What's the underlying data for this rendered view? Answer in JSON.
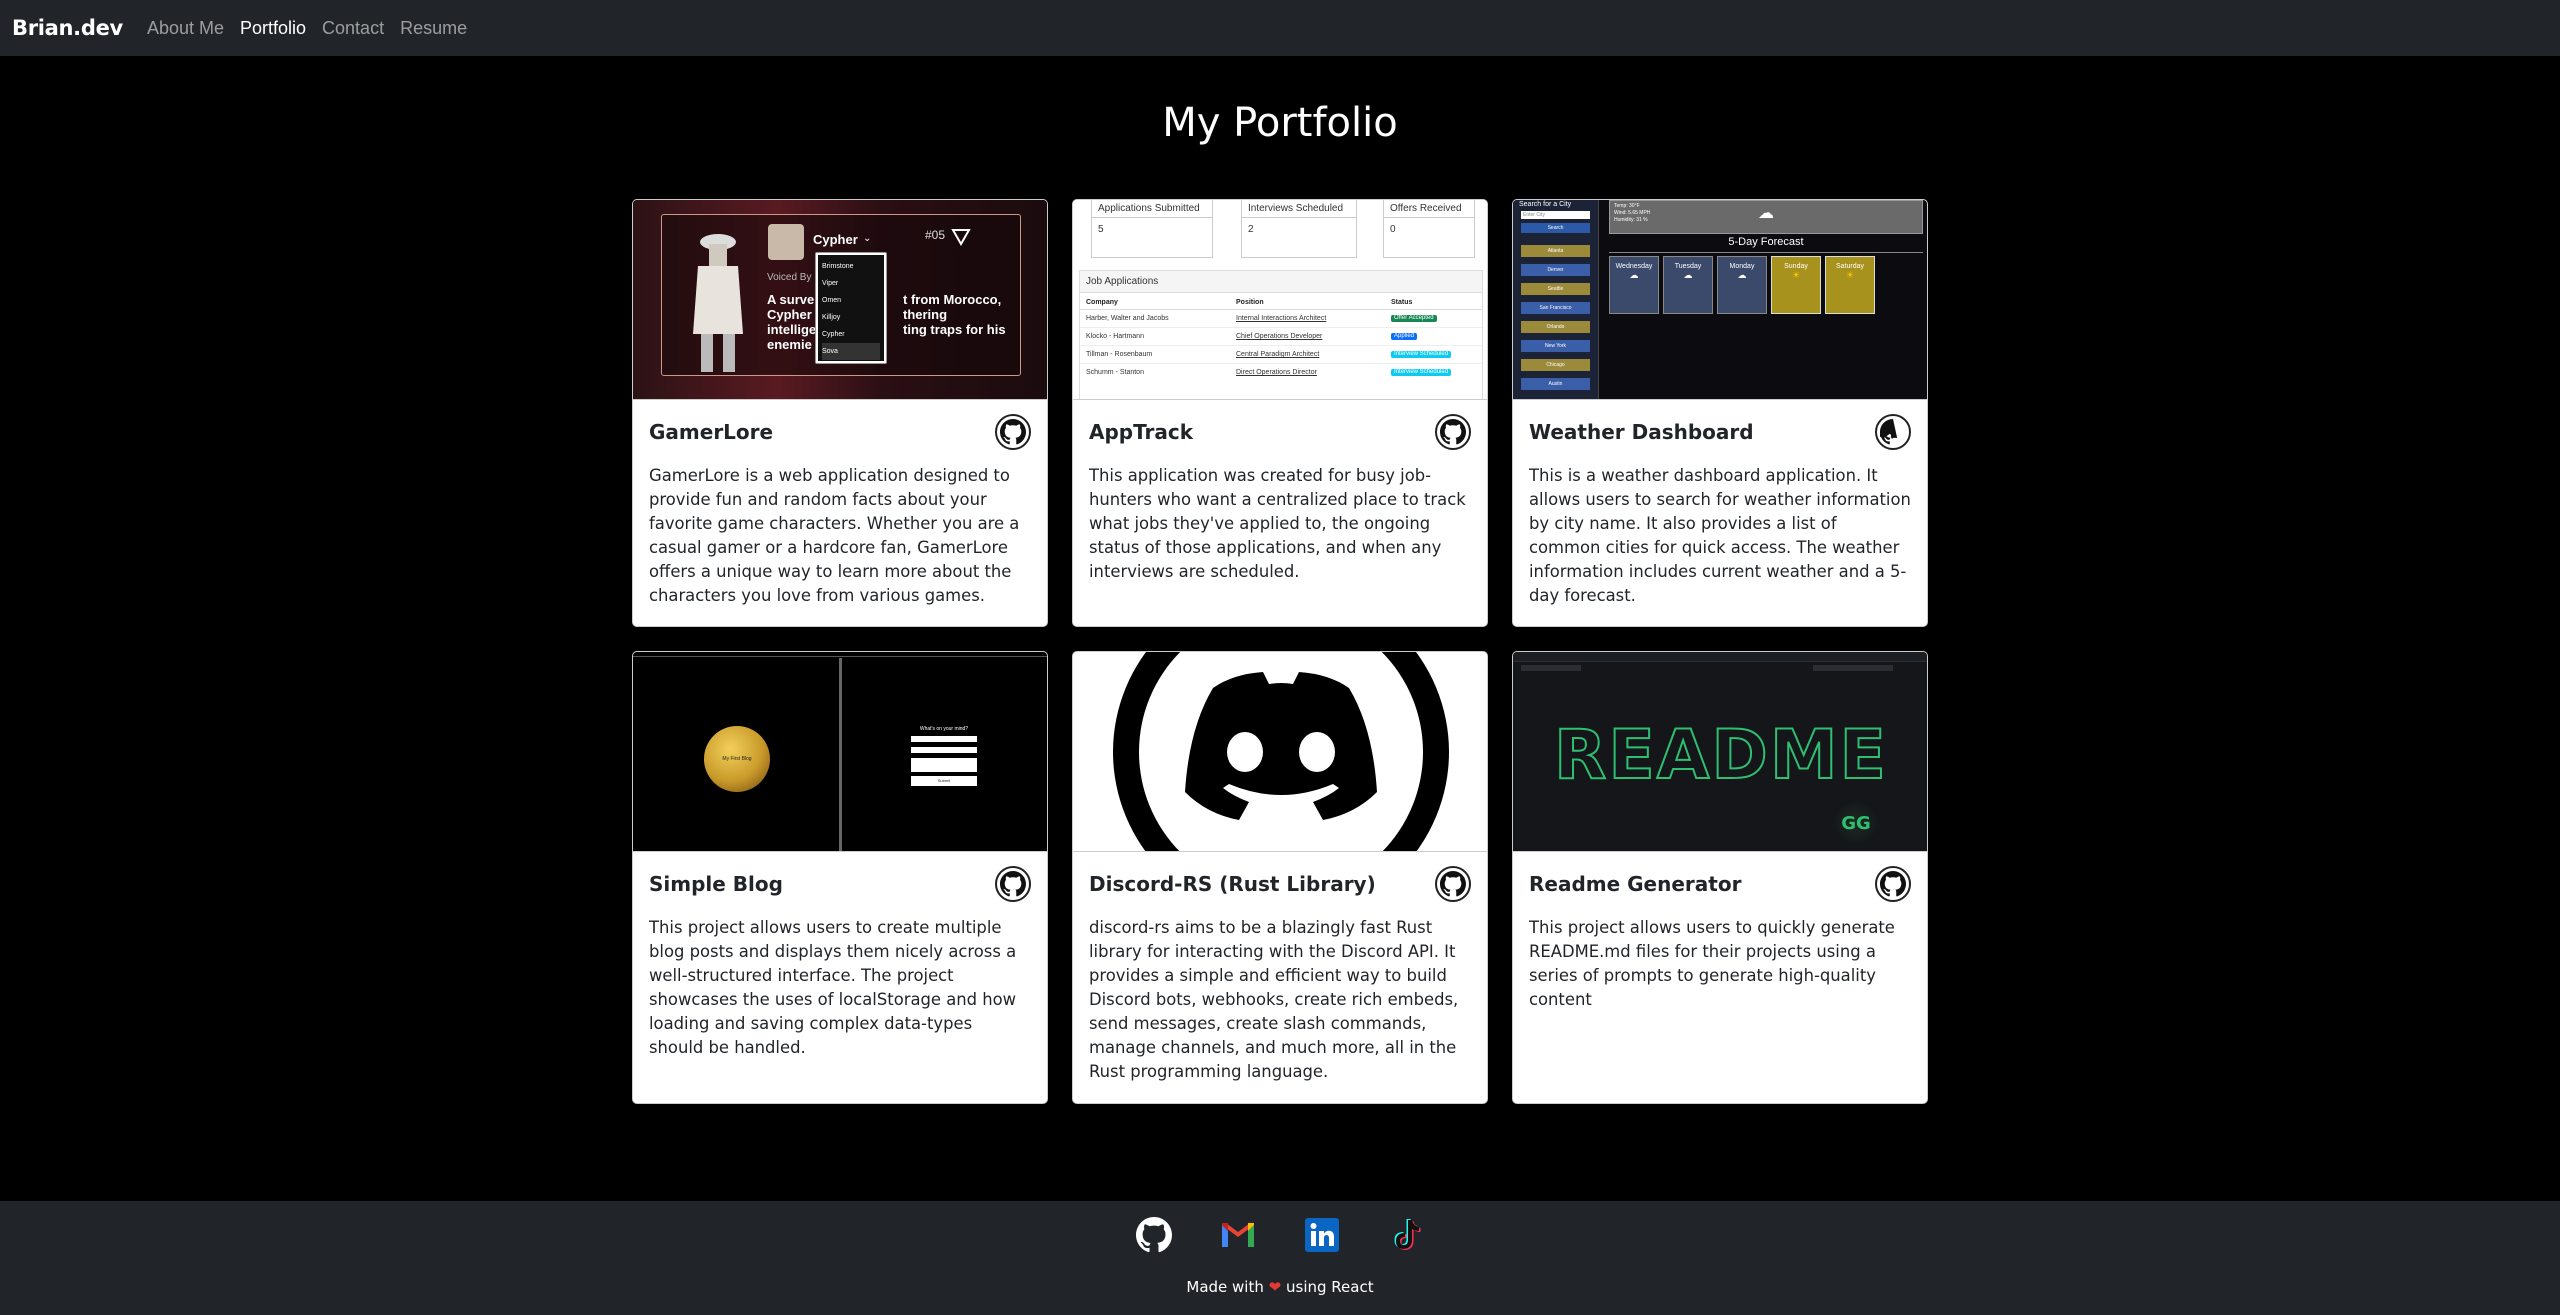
{
  "nav": {
    "brand": "Brian.dev",
    "links": [
      "About Me",
      "Portfolio",
      "Contact",
      "Resume"
    ],
    "active_index": 1
  },
  "page_title": "My Portfolio",
  "projects": [
    {
      "title": "GamerLore",
      "description": "GamerLore is a web application designed to provide fun and random facts about your favorite game characters. Whether you are a casual gamer or a hardcore fan, GamerLore offers a unique way to learn more about the characters you love from various games.",
      "thumb": {
        "character": "Cypher",
        "number": "#05",
        "voiced_by": "Voiced By",
        "bio_fragments": [
          "A surve",
          "t from Morocco,",
          "Cypher",
          "thering",
          "intellige",
          "ting traps for his",
          "enemie"
        ],
        "dropdown": [
          "Brimstone",
          "Viper",
          "Omen",
          "Killjoy",
          "Cypher",
          "Sova"
        ]
      }
    },
    {
      "title": "AppTrack",
      "description": "This application was created for busy job-hunters who want a centralized place to track what jobs they've applied to, the ongoing status of those applications, and when any interviews are scheduled.",
      "thumb": {
        "stats": [
          {
            "label": "Applications Submitted",
            "value": "5"
          },
          {
            "label": "Interviews Scheduled",
            "value": "2"
          },
          {
            "label": "Offers Received",
            "value": "0"
          }
        ],
        "section": "Job Applications",
        "columns": [
          "Company",
          "Position",
          "Status"
        ],
        "rows": [
          [
            "Harber, Walter and Jacobs",
            "Internal Interactions Architect",
            "Offer Accepted"
          ],
          [
            "Klocko - Hartmann",
            "Chief Operations Developer",
            "Applied"
          ],
          [
            "Tillman - Rosenbaum",
            "Central Paradigm Architect",
            "Interview Scheduled"
          ],
          [
            "Schumm - Stanton",
            "Direct Operations Director",
            "Interview Scheduled"
          ]
        ]
      }
    },
    {
      "title": "Weather Dashboard",
      "description": "This is a weather dashboard application. It allows users to search for weather information by city name. It also provides a list of common cities for quick access. The weather information includes current weather and a 5-day forecast.",
      "thumb": {
        "search_title": "Search for a City",
        "search_placeholder": "Enter City",
        "search_button": "Search",
        "cities": [
          "Atlanta",
          "Denver",
          "Seattle",
          "San Francisco",
          "Orlando",
          "New York",
          "Chicago",
          "Austin"
        ],
        "current_lines": [
          "Temp: 30°F",
          "Wind: 5.65 MPH",
          "Humidity: 31 %"
        ],
        "forecast_title": "5-Day Forecast",
        "days": [
          "Wednesday",
          "Tuesday",
          "Monday",
          "Sunday",
          "Saturday"
        ]
      }
    },
    {
      "title": "Simple Blog",
      "description": "This project allows users to create multiple blog posts and displays them nicely across a well-structured interface. The project showcases the uses of localStorage and how loading and saving complex data-types should be handled.",
      "thumb": {
        "circle_label": "My First Blog",
        "form_title": "What's on your mind?",
        "form_button": "Submit"
      }
    },
    {
      "title": "Discord-RS (Rust Library)",
      "description": "discord-rs aims to be a blazingly fast Rust library for interacting with the Discord API. It provides a simple and efficient way to build Discord bots, webhooks, create rich embeds, send messages, create slash commands, manage channels, and much more, all in the Rust programming language.",
      "thumb": {}
    },
    {
      "title": "Readme Generator",
      "description": "This project allows users to quickly generate README.md files for their projects using a series of prompts to generate high-quality content",
      "thumb": {
        "big_text": "README",
        "logo": "GG"
      }
    }
  ],
  "footer": {
    "socials": [
      "github-icon",
      "gmail-icon",
      "linkedin-icon",
      "tiktok-icon"
    ],
    "made_prefix": "Made with",
    "made_heart": "❤",
    "made_suffix": "using React"
  },
  "colors": {
    "navbar_bg": "#212529",
    "page_bg": "#000000",
    "card_bg": "#ffffff",
    "heart": "#e53935",
    "gmail_red": "#ea4335",
    "linkedin_blue": "#0a66c2"
  }
}
